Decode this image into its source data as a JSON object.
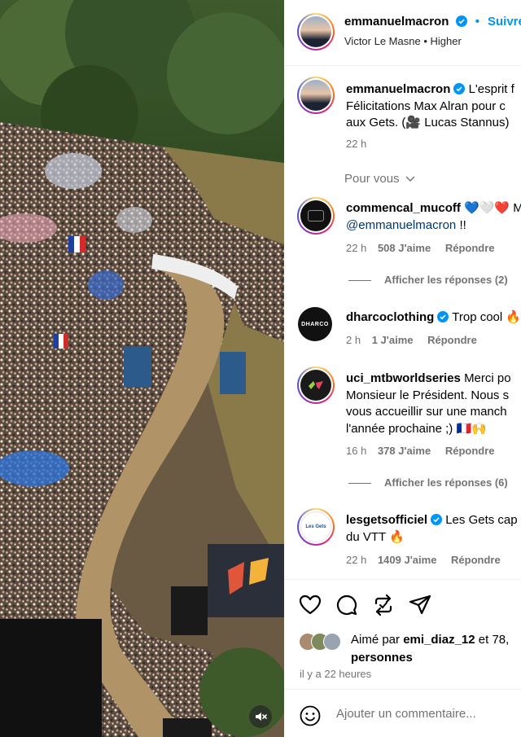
{
  "media": {
    "mute_icon": "speaker-muted-icon"
  },
  "header": {
    "username": "emmanuelmacron",
    "separator": "•",
    "follow_label": "Suivre",
    "audio_artist": "Victor Le Masne",
    "audio_separator": "•",
    "audio_title": "Higher"
  },
  "caption": {
    "username": "emmanuelmacron",
    "line1": "L'esprit f",
    "line2": "Félicitations Max Alran pour c",
    "line3": "aux Gets. (🎥 Lucas Stannus)",
    "time": "22 h"
  },
  "for_you_label": "Pour vous",
  "comments": [
    {
      "username": "commencal_mucoff",
      "text1": "💙🤍❤️ M",
      "text2_mention": "@emmanuelmacron",
      "text2_rest": " !!",
      "time": "22 h",
      "likes": "508 J'aime",
      "reply": "Répondre",
      "view_replies": "Afficher les réponses (2)"
    },
    {
      "username": "dharcoclothing",
      "text1": "Trop cool 🔥",
      "time": "2 h",
      "likes": "1 J'aime",
      "reply": "Répondre",
      "avatar_text": "DHARCO"
    },
    {
      "username": "uci_mtbworldseries",
      "text1": "Merci po",
      "text2": "Monsieur le Président. Nous s",
      "text3": "vous accueillir sur une manch",
      "text4": "l'année prochaine ;) 🇫🇷🙌",
      "time": "16 h",
      "likes": "378 J'aime",
      "reply": "Répondre",
      "view_replies": "Afficher les réponses (6)"
    },
    {
      "username": "lesgetsofficiel",
      "text1": "Les Gets cap",
      "text2": "du VTT 🔥",
      "time": "22 h",
      "likes": "1409 J'aime",
      "reply": "Répondre",
      "avatar_text": "Les Gets"
    }
  ],
  "actions": {
    "like_icon": "heart-icon",
    "comment_icon": "comment-bubble-icon",
    "repost_icon": "repost-icon",
    "share_icon": "paper-plane-icon"
  },
  "liked_by": {
    "prefix": "Aimé par ",
    "user": "emi_diaz_12",
    "middle": " et 78,",
    "suffix": "personnes"
  },
  "posted_ago": "il y a 22 heures",
  "add_comment": {
    "placeholder": "Ajouter un commentaire..."
  },
  "colors": {
    "accent": "#0095f6",
    "secondary_text": "#737373",
    "verified": "#0095f6",
    "mention": "#00376b"
  }
}
